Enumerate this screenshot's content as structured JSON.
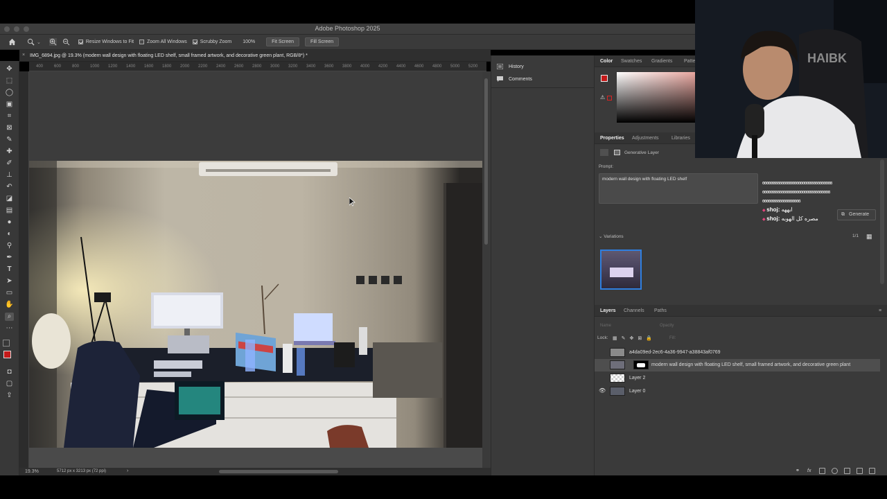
{
  "app": {
    "title": "Adobe Photoshop 2025"
  },
  "options_bar": {
    "resize_windows": "Resize Windows to Fit",
    "zoom_all_windows": "Zoom All Windows",
    "scrubby_zoom": "Scrubby Zoom",
    "zoom_value": "100%",
    "fit_screen": "Fit Screen",
    "fill_screen": "Fill Screen"
  },
  "document": {
    "tab_title": "IMG_6894.jpg @ 19.3% (modern wall design with floating LED shelf, small framed artwork, and decorative green plant, RGB/8*) *",
    "ruler_ticks": [
      "400",
      "600",
      "800",
      "1000",
      "1200",
      "1400",
      "1600",
      "1800",
      "2000",
      "2200",
      "2400",
      "2600",
      "2800",
      "3000",
      "3200",
      "3400",
      "3600",
      "3800",
      "4000",
      "4200",
      "4400",
      "4600",
      "4800",
      "5000",
      "5200"
    ],
    "zoom": "19.3%",
    "dimensions": "5712 px x 3213 px (72 ppi)"
  },
  "history_panel": {
    "items": [
      "History",
      "Comments"
    ]
  },
  "color_panel": {
    "tabs": [
      "Color",
      "Swatches",
      "Gradients",
      "Patte"
    ],
    "foreground": "#c41a1a"
  },
  "properties_panel": {
    "tabs": [
      "Properties",
      "Adjustments",
      "Libraries"
    ],
    "layer_type": "Generative Layer",
    "prompt_label": "Prompt:",
    "prompt_text": "modern wall design with floating LED shelf",
    "generate_label": "Generate",
    "variations_label": "Variations",
    "variations_count": "1/1"
  },
  "layers_panel": {
    "tabs": [
      "Layers",
      "Channels",
      "Paths"
    ],
    "kind_label": "Name",
    "opacity_label": "Opacity",
    "lock_label": "Lock:",
    "fill_label": "Fill:",
    "layers": [
      {
        "name": "a4da09ed-2ec6-4a36-9947-a38843af0769",
        "visible": false,
        "selected": false
      },
      {
        "name": "modern wall design with floating LED shelf, small framed artwork, and decorative green plant",
        "visible": false,
        "selected": true
      },
      {
        "name": "Layer 2",
        "visible": false,
        "selected": false
      },
      {
        "name": "Layer 0",
        "visible": true,
        "selected": false
      }
    ]
  },
  "chat": {
    "lines": [
      {
        "user": "",
        "text": "ɞɞɞɞɞɞɞɞɞɞɞɞɞɞɞɞɞɞɞɞɞɞɞɞɞɞɞɞɞɞɞɞɞ"
      },
      {
        "user": "",
        "text": "ɞɞɞɞɞɞɞɞɞɞɞɞɞɞɞɞɞɞɞɞɞɞɞɞɞɞɞɞɞɞɞɞ"
      },
      {
        "user": "",
        "text": "ɞɞɞɞɞɞɞɞɞɞɞɞɞɞɞɞɞɞ"
      },
      {
        "user": "shoj:",
        "text": "ابههه"
      },
      {
        "user": "shoj:",
        "text": "مصره كل الهوبه"
      }
    ]
  },
  "webcam": {
    "chair_text": "HAIBK"
  }
}
